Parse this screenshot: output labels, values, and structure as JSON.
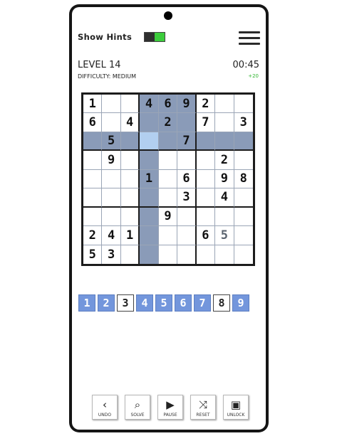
{
  "header": {
    "show_hints_label": "Show Hints",
    "show_hints_on": true,
    "level": "LEVEL 14",
    "difficulty": "DIFFICULTY: MEDIUM",
    "timer": "00:45",
    "bonus": "+20"
  },
  "board": {
    "cells": [
      [
        "1",
        "",
        "",
        "4",
        "6",
        "9",
        "2",
        "",
        ""
      ],
      [
        "6",
        "",
        "4",
        "",
        "2",
        "",
        "7",
        "",
        "3"
      ],
      [
        "",
        "5",
        "",
        "",
        "",
        "7",
        "",
        "",
        ""
      ],
      [
        "",
        "9",
        "",
        "",
        "",
        "",
        "",
        "2",
        ""
      ],
      [
        "",
        "",
        "",
        "1",
        "",
        "6",
        "",
        "9",
        "8"
      ],
      [
        "",
        "",
        "",
        "",
        "",
        "3",
        "",
        "4",
        ""
      ],
      [
        "",
        "",
        "",
        "",
        "9",
        "",
        "",
        "",
        ""
      ],
      [
        "2",
        "4",
        "1",
        "",
        "",
        "",
        "6",
        "5",
        ""
      ],
      [
        "5",
        "3",
        "",
        "",
        "",
        "",
        "",
        "",
        ""
      ]
    ],
    "entered": [
      [
        7,
        7
      ]
    ],
    "selected": [
      2,
      3
    ],
    "highlight_rows": [
      2
    ],
    "highlight_cols": [
      3
    ],
    "highlight_box_top": [
      [
        0,
        3
      ],
      [
        0,
        4
      ],
      [
        0,
        5
      ],
      [
        1,
        3
      ],
      [
        1,
        4
      ],
      [
        1,
        5
      ],
      [
        2,
        3
      ],
      [
        2,
        4
      ],
      [
        2,
        5
      ]
    ],
    "selected_color": "#b2cff0",
    "highlight_color": "#8a9bb8"
  },
  "numbers": [
    {
      "label": "1",
      "done": false
    },
    {
      "label": "2",
      "done": false
    },
    {
      "label": "3",
      "done": true
    },
    {
      "label": "4",
      "done": false
    },
    {
      "label": "5",
      "done": false
    },
    {
      "label": "6",
      "done": false
    },
    {
      "label": "7",
      "done": false
    },
    {
      "label": "8",
      "done": true
    },
    {
      "label": "9",
      "done": false
    }
  ],
  "toolbar": [
    {
      "label": "UNDO",
      "icon": "chevron-left-icon",
      "glyph": "‹"
    },
    {
      "label": "SOLVE",
      "icon": "magnifier-icon",
      "glyph": "⌕"
    },
    {
      "label": "PAUSE",
      "icon": "play-icon",
      "glyph": "▶"
    },
    {
      "label": "RESET",
      "icon": "shuffle-icon",
      "glyph": "⤨"
    },
    {
      "label": "UNLOCK",
      "icon": "lock-icon",
      "glyph": "▣"
    }
  ],
  "colors": {
    "accent": "#7396dc",
    "toggle_on": "#3ccc3c",
    "bonus": "#2fb52f"
  }
}
